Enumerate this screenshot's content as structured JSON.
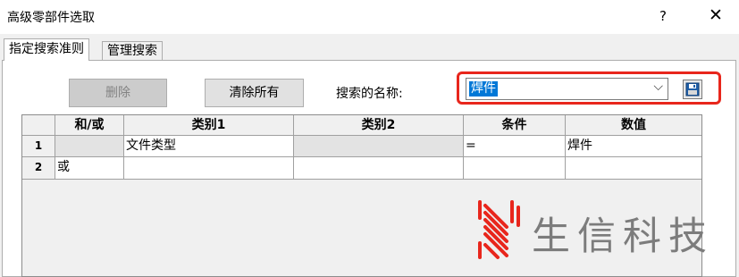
{
  "window": {
    "title": "高级零部件选取",
    "help": "?",
    "close": "✕"
  },
  "tabs": [
    {
      "label": "指定搜索准则"
    },
    {
      "label": "管理搜索"
    }
  ],
  "toolbar": {
    "delete_label": "删除",
    "clear_label": "清除所有",
    "search_name_label": "搜索的名称:"
  },
  "search_name": {
    "value": "焊件",
    "arrow": "⌵",
    "save_icon": "floppy-disk-icon"
  },
  "grid": {
    "columns": [
      "和/或",
      "类别1",
      "类别2",
      "条件",
      "数值"
    ],
    "rows": [
      {
        "num": "1",
        "cells": [
          "",
          "文件类型",
          "",
          "=",
          "焊件"
        ]
      },
      {
        "num": "2",
        "cells": [
          "或",
          "",
          "",
          "",
          ""
        ]
      }
    ]
  },
  "watermark": {
    "text": "生信科技"
  },
  "colors": {
    "highlight": "#e8261c",
    "selection": "#0078d7",
    "watermark_text": "#7c7c7c"
  }
}
